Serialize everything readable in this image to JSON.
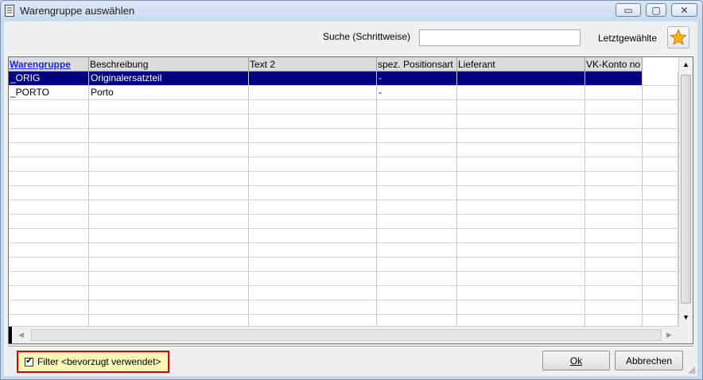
{
  "window": {
    "title": "Warengruppe auswählen",
    "controls": {
      "minimize": "▭",
      "maximize": "▢",
      "close": "✕"
    }
  },
  "search": {
    "label": "Suche (Schrittweise)",
    "value": "",
    "placeholder": ""
  },
  "recent": {
    "label": "Letztgewählte",
    "icon": "star-icon"
  },
  "grid": {
    "columns": [
      {
        "label": "Warengruppe",
        "sorted": true
      },
      {
        "label": "Beschreibung",
        "sorted": false
      },
      {
        "label": "Text 2",
        "sorted": false
      },
      {
        "label": "spez. Positionsart",
        "sorted": false
      },
      {
        "label": "Lieferant",
        "sorted": false
      },
      {
        "label": "VK-Konto no",
        "sorted": false
      }
    ],
    "rows": [
      {
        "cells": [
          "_ORIG",
          "Originalersatzteil",
          "",
          "-",
          "",
          ""
        ],
        "selected": true
      },
      {
        "cells": [
          "_PORTO",
          "Porto",
          "",
          "-",
          "",
          ""
        ],
        "selected": false
      }
    ],
    "selection_color": "#000080",
    "sort_color": "#1a2bd6"
  },
  "footer": {
    "filter_label": "Filter <bevorzugt verwendet>",
    "filter_checked": true,
    "ok_label": "Ok",
    "cancel_label": "Abbrechen",
    "highlight_color": "#e00000"
  }
}
